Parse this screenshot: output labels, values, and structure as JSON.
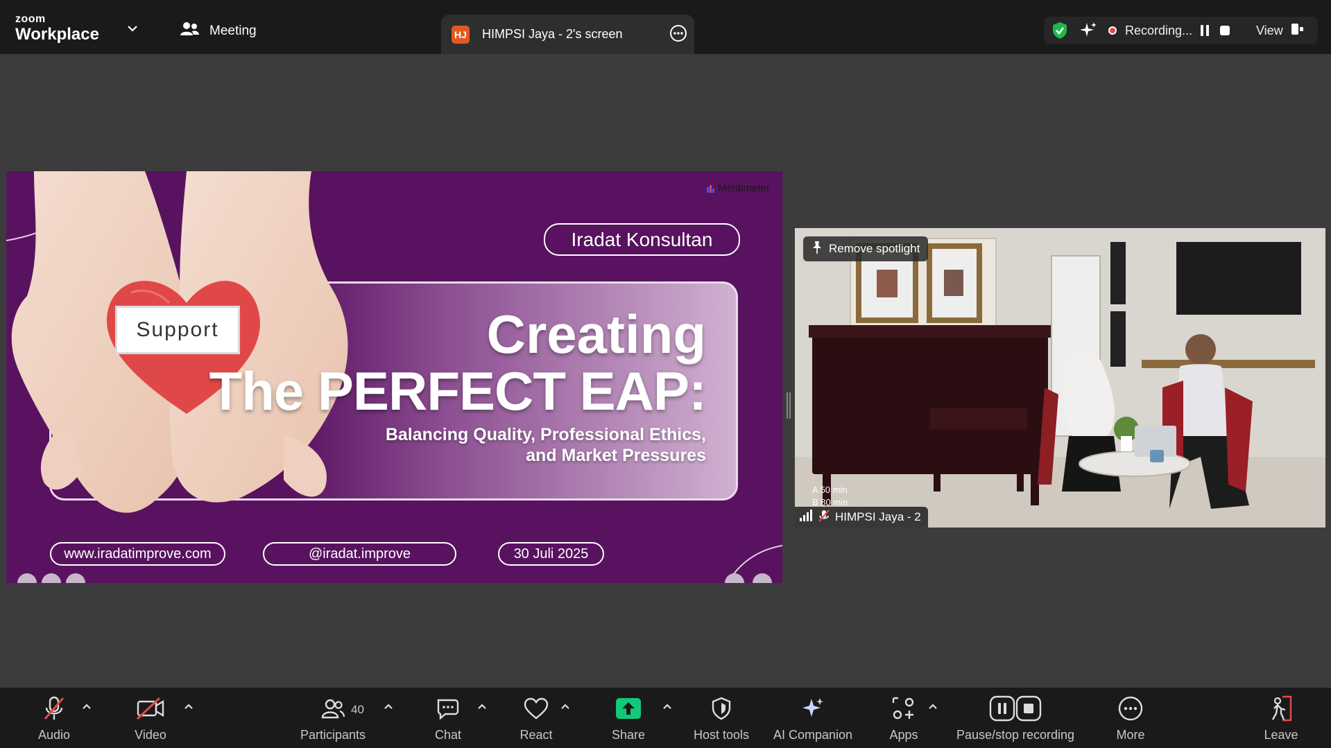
{
  "app": {
    "brand_top": "zoom",
    "brand_bottom": "Workplace",
    "meeting_label": "Meeting"
  },
  "screen_tab": {
    "badge": "HJ",
    "label": "HIMPSI Jaya - 2's screen"
  },
  "recording": {
    "status": "Recording...",
    "view_label": "View"
  },
  "slide": {
    "brand": "Mentimeter",
    "company": "Iradat Konsultan",
    "card_text": "Support",
    "title_line1": "Creating",
    "title_line2": "The PERFECT EAP:",
    "subtitle_line1": "Balancing Quality, Professional Ethics,",
    "subtitle_line2": "and Market Pressures",
    "website": "www.iradatimprove.com",
    "instagram": "@iradat.improve",
    "date": "30 Juli 2025"
  },
  "video": {
    "spotlight_button": "Remove spotlight",
    "participant_name": "HIMPSI Jaya - 2",
    "note_a": "A  50 min",
    "note_b": "B  80 min"
  },
  "toolbar": {
    "audio": "Audio",
    "video": "Video",
    "participants": "Participants",
    "participants_count": "40",
    "chat": "Chat",
    "react": "React",
    "share": "Share",
    "host_tools": "Host tools",
    "ai_companion": "AI Companion",
    "apps": "Apps",
    "pause_stop": "Pause/stop recording",
    "more": "More",
    "leave": "Leave"
  },
  "colors": {
    "slide_bg": "#58125f",
    "share_green": "#10c97a",
    "leave_red": "#e5484d",
    "secure_green": "#1fb84f"
  }
}
